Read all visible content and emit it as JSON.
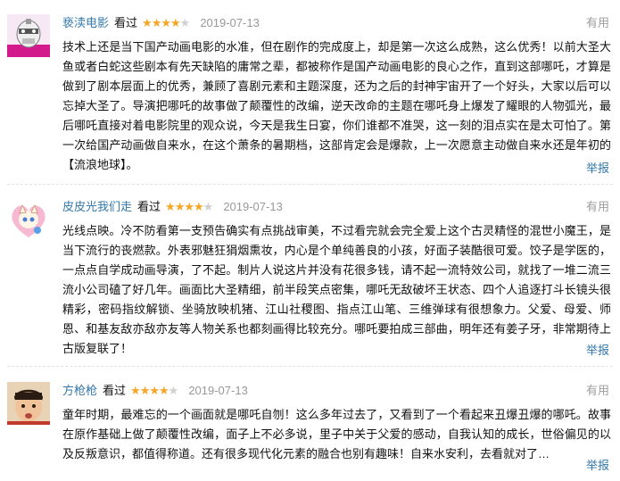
{
  "reviews": [
    {
      "author": "亵渎电影",
      "action": "看过",
      "rating": 4,
      "date": "2019-07-13",
      "useful": "有用",
      "report": "举报",
      "avatar_icon": "robot-mask-avatar-icon",
      "text": "技术上还是当下国产动画电影的水准，但在剧作的完成度上，却是第一次这么成熟，这么优秀！以前大圣大鱼或者白蛇这些剧本有先天缺陷的庸常之辈，都被称作是国产动画电影的良心之作，直到这部哪吒，才算是做到了剧本层面上的优秀，兼顾了喜剧元素和主题深度，还为之后的封神宇宙开了一个好头，大家以后可以忘掉大圣了。导演把哪吒的故事做了颠覆性的改编，逆天改命的主题在哪吒身上爆发了耀眼的人物弧光，最后哪吒直接对着电影院里的观众说，今天是我生日宴，你们谁都不准哭，这一刻的泪点实在是太可怕了。第一次给国产动画做自来水，在这个萧条的暑期档，这部肯定会是爆款，上一次愿意主动做自来水还是年初的【流浪地球】。"
    },
    {
      "author": "皮皮光我们走",
      "action": "看过",
      "rating": 4,
      "date": "2019-07-13",
      "useful": "有用",
      "report": "举报",
      "avatar_icon": "anime-cat-heart-avatar-icon",
      "text": "光线点映。冷不防看第一支预告确实有点挑战审美，不过看完就会完全爱上这个古灵精怪的混世小魔王，是当下流行的丧燃款。外表邪魅狂狷烟熏妆，内心是个单纯善良的小孩，好面子装酷很可爱。饺子是学医的，一点点自学成动画导演，了不起。制片人说这片并没有花很多钱，请不起一流特效公司，就找了一堆二流三流小公司磕了好几年。画面比大圣精细，前半段笑点密集，哪吒无敌破坏王状态、四个人追逐打斗长镜头很精彩，密码指纹解锁、坐骑放映机猪、江山社稷图、指点江山笔、三维弹球有很想象力。父爱、母爱、师恩、和基友敌亦敌亦友等人物关系也都刻画得比较充分。哪吒要拍成三部曲，明年还有姜子牙，非常期待上古版复联了！"
    },
    {
      "author": "方枪枪",
      "action": "看过",
      "rating": 4,
      "date": "2019-07-13",
      "useful": "有用",
      "report": "举报",
      "avatar_icon": "child-photo-avatar-icon",
      "text": "童年时期，最难忘的一个画面就是哪吒自刎！这么多年过去了，又看到了一个看起来丑爆丑爆的哪吒。故事在原作基础上做了颠覆性改编，面子上不必多说，里子中关于父爱的感动，自我认知的成长，世俗偏见的以及反叛意识，都值得称道。还有很多现代化元素的融合也别有趣味！自来水安利，去看就对了…"
    }
  ]
}
